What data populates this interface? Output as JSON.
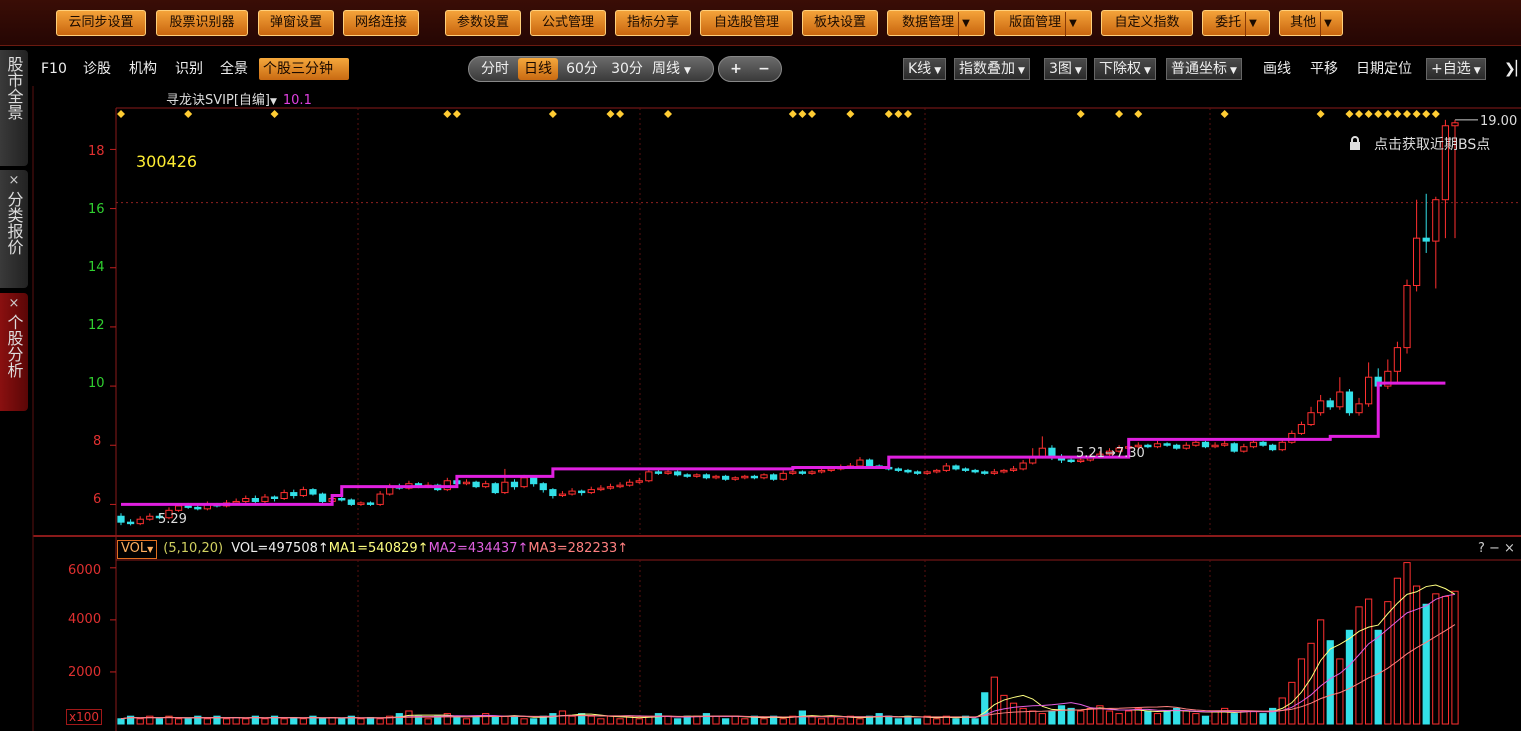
{
  "toolbar": {
    "buttons": [
      {
        "label": "云同步设置"
      },
      {
        "label": "股票识别器"
      },
      {
        "label": "弹窗设置"
      },
      {
        "label": "网络连接"
      },
      {
        "label": "参数设置"
      },
      {
        "label": "公式管理"
      },
      {
        "label": "指标分享"
      },
      {
        "label": "自选股管理"
      },
      {
        "label": "板块设置"
      },
      {
        "label": "数据管理"
      },
      {
        "label": "版面管理"
      },
      {
        "label": "自定义指数"
      },
      {
        "label": "委托"
      },
      {
        "label": "其他"
      }
    ]
  },
  "sidebar": {
    "tabs": [
      {
        "label": "股市全景"
      },
      {
        "label": "分类报价"
      },
      {
        "label": "个股分析"
      }
    ],
    "close_glyph": "×"
  },
  "subnav": {
    "items": [
      "F10",
      "诊股",
      "机构",
      "识别",
      "全景",
      "个股三分钟"
    ],
    "active": "个股三分钟",
    "periods": [
      "分时",
      "日线",
      "60分",
      "30分",
      "周线"
    ],
    "active_period": "日线",
    "zoom_in": "+",
    "zoom_out": "−",
    "right_buttons": [
      {
        "label": "K线",
        "dropdown": true
      },
      {
        "label": "指数叠加",
        "dropdown": true
      },
      {
        "label": "3图",
        "dropdown": true
      },
      {
        "label": "下除权",
        "dropdown": true
      },
      {
        "label": "普通坐标",
        "dropdown": true
      },
      {
        "label": "画线",
        "dropdown": false
      },
      {
        "label": "平移",
        "dropdown": false
      },
      {
        "label": "日期定位",
        "dropdown": false
      },
      {
        "label": "+自选",
        "dropdown": true
      }
    ],
    "collapse_icon": "sidebar-collapse-icon"
  },
  "indicator": {
    "name": "寻龙诀SVIP[自编]",
    "value": "10.1"
  },
  "stock": {
    "code": "300426"
  },
  "bs_hint": "点击获取近期BS点",
  "price_labels": {
    "max": "19.00",
    "min": "5.29",
    "mid": "5.21→7.30"
  },
  "volume_panel": {
    "indicator_button": "VOL",
    "params": "(5,10,20)",
    "vol": "VOL=497508↑",
    "ma1": "MA1=540829↑",
    "ma2": "MA2=434437↑",
    "ma3": "MA3=282233↑",
    "right_controls": "? − ×",
    "unit": "x100"
  },
  "colors": {
    "up": "#ff3030",
    "down": "#33e0e8",
    "indicator_line": "#e020e0",
    "signal": "#ffcc33",
    "ma1": "#ffff80",
    "ma2": "#e060e0",
    "ma3": "#ff8080",
    "toolbar_button": "#e8902a"
  },
  "chart_data": {
    "type": "candlestick",
    "price_axis": {
      "ticks": [
        6,
        8,
        10,
        12,
        14,
        16,
        18
      ],
      "ylim": [
        5,
        19.4
      ]
    },
    "volume_axis": {
      "ticks": [
        2000,
        4000,
        6000
      ],
      "ylim": [
        0,
        6300
      ]
    },
    "level_line": [
      {
        "from": 0,
        "to": 22,
        "value": 6.0
      },
      {
        "from": 22,
        "to": 23,
        "value": 6.3
      },
      {
        "from": 23,
        "to": 35,
        "value": 6.6
      },
      {
        "from": 35,
        "to": 45,
        "value": 6.95
      },
      {
        "from": 45,
        "to": 70,
        "value": 7.2
      },
      {
        "from": 70,
        "to": 80,
        "value": 7.25
      },
      {
        "from": 80,
        "to": 105,
        "value": 7.6
      },
      {
        "from": 105,
        "to": 126,
        "value": 8.2
      },
      {
        "from": 126,
        "to": 131,
        "value": 8.3
      },
      {
        "from": 131,
        "to": 138,
        "value": 10.1
      }
    ],
    "candles": [
      [
        5.6,
        5.4,
        5.7,
        5.3
      ],
      [
        5.4,
        5.35,
        5.5,
        5.29
      ],
      [
        5.35,
        5.5,
        5.6,
        5.3
      ],
      [
        5.5,
        5.6,
        5.7,
        5.45
      ],
      [
        5.6,
        5.55,
        5.7,
        5.5
      ],
      [
        5.55,
        5.8,
        5.9,
        5.5
      ],
      [
        5.8,
        5.95,
        6.0,
        5.75
      ],
      [
        5.95,
        5.9,
        6.05,
        5.85
      ],
      [
        5.9,
        5.85,
        6.0,
        5.8
      ],
      [
        5.85,
        6.0,
        6.1,
        5.8
      ],
      [
        6.0,
        5.95,
        6.05,
        5.9
      ],
      [
        5.95,
        6.05,
        6.15,
        5.9
      ],
      [
        6.05,
        6.1,
        6.2,
        6.0
      ],
      [
        6.1,
        6.2,
        6.3,
        6.05
      ],
      [
        6.2,
        6.1,
        6.3,
        6.05
      ],
      [
        6.1,
        6.25,
        6.35,
        6.05
      ],
      [
        6.25,
        6.2,
        6.3,
        6.1
      ],
      [
        6.2,
        6.4,
        6.5,
        6.15
      ],
      [
        6.4,
        6.3,
        6.5,
        6.2
      ],
      [
        6.3,
        6.5,
        6.6,
        6.25
      ],
      [
        6.5,
        6.35,
        6.55,
        6.3
      ],
      [
        6.35,
        6.1,
        6.4,
        6.0
      ],
      [
        6.1,
        6.2,
        6.3,
        6.05
      ],
      [
        6.2,
        6.15,
        6.25,
        6.1
      ],
      [
        6.15,
        6.0,
        6.2,
        5.95
      ],
      [
        6.0,
        6.05,
        6.1,
        5.95
      ],
      [
        6.05,
        6.0,
        6.1,
        5.95
      ],
      [
        6.0,
        6.35,
        6.45,
        5.95
      ],
      [
        6.35,
        6.6,
        6.7,
        6.3
      ],
      [
        6.6,
        6.55,
        6.7,
        6.5
      ],
      [
        6.55,
        6.7,
        6.8,
        6.5
      ],
      [
        6.7,
        6.6,
        6.75,
        6.55
      ],
      [
        6.6,
        6.65,
        6.75,
        6.55
      ],
      [
        6.65,
        6.5,
        6.7,
        6.45
      ],
      [
        6.5,
        6.8,
        6.9,
        6.45
      ],
      [
        6.8,
        6.7,
        6.9,
        6.65
      ],
      [
        6.7,
        6.75,
        6.85,
        6.65
      ],
      [
        6.75,
        6.6,
        6.8,
        6.55
      ],
      [
        6.6,
        6.7,
        6.8,
        6.55
      ],
      [
        6.7,
        6.4,
        6.75,
        6.35
      ],
      [
        6.4,
        6.75,
        7.2,
        6.35
      ],
      [
        6.75,
        6.6,
        6.85,
        6.5
      ],
      [
        6.6,
        6.9,
        7.0,
        6.55
      ],
      [
        6.9,
        6.7,
        6.95,
        6.6
      ],
      [
        6.7,
        6.5,
        6.75,
        6.4
      ],
      [
        6.5,
        6.3,
        6.55,
        6.2
      ],
      [
        6.3,
        6.35,
        6.45,
        6.25
      ],
      [
        6.35,
        6.45,
        6.55,
        6.3
      ],
      [
        6.45,
        6.4,
        6.5,
        6.3
      ],
      [
        6.4,
        6.5,
        6.6,
        6.35
      ],
      [
        6.5,
        6.55,
        6.65,
        6.45
      ],
      [
        6.55,
        6.6,
        6.7,
        6.5
      ],
      [
        6.6,
        6.65,
        6.75,
        6.55
      ],
      [
        6.65,
        6.75,
        6.85,
        6.6
      ],
      [
        6.75,
        6.8,
        6.9,
        6.7
      ],
      [
        6.8,
        7.1,
        7.25,
        6.75
      ],
      [
        7.1,
        7.05,
        7.2,
        7.0
      ],
      [
        7.05,
        7.1,
        7.2,
        7.0
      ],
      [
        7.1,
        7.0,
        7.15,
        6.95
      ],
      [
        7.0,
        6.95,
        7.05,
        6.9
      ],
      [
        6.95,
        7.0,
        7.05,
        6.9
      ],
      [
        7.0,
        6.9,
        7.05,
        6.85
      ],
      [
        6.9,
        6.95,
        7.0,
        6.85
      ],
      [
        6.95,
        6.85,
        7.0,
        6.8
      ],
      [
        6.85,
        6.9,
        6.95,
        6.8
      ],
      [
        6.9,
        6.95,
        7.0,
        6.85
      ],
      [
        6.95,
        6.9,
        7.0,
        6.85
      ],
      [
        6.9,
        7.0,
        7.05,
        6.85
      ],
      [
        7.0,
        6.85,
        7.05,
        6.8
      ],
      [
        6.85,
        7.05,
        7.15,
        6.8
      ],
      [
        7.05,
        7.1,
        7.2,
        7.0
      ],
      [
        7.1,
        7.05,
        7.15,
        7.0
      ],
      [
        7.05,
        7.1,
        7.15,
        7.0
      ],
      [
        7.1,
        7.15,
        7.2,
        7.05
      ],
      [
        7.15,
        7.2,
        7.3,
        7.1
      ],
      [
        7.2,
        7.25,
        7.35,
        7.15
      ],
      [
        7.25,
        7.3,
        7.4,
        7.2
      ],
      [
        7.3,
        7.5,
        7.6,
        7.25
      ],
      [
        7.5,
        7.3,
        7.55,
        7.2
      ],
      [
        7.3,
        7.25,
        7.35,
        7.2
      ],
      [
        7.25,
        7.2,
        7.3,
        7.15
      ],
      [
        7.2,
        7.15,
        7.25,
        7.1
      ],
      [
        7.15,
        7.1,
        7.2,
        7.05
      ],
      [
        7.1,
        7.05,
        7.15,
        7.0
      ],
      [
        7.05,
        7.1,
        7.15,
        7.0
      ],
      [
        7.1,
        7.15,
        7.2,
        7.05
      ],
      [
        7.15,
        7.3,
        7.4,
        7.1
      ],
      [
        7.3,
        7.2,
        7.35,
        7.15
      ],
      [
        7.2,
        7.15,
        7.25,
        7.1
      ],
      [
        7.15,
        7.1,
        7.2,
        7.05
      ],
      [
        7.1,
        7.05,
        7.15,
        7.0
      ],
      [
        7.05,
        7.1,
        7.2,
        7.0
      ],
      [
        7.1,
        7.15,
        7.2,
        7.05
      ],
      [
        7.15,
        7.2,
        7.3,
        7.1
      ],
      [
        7.2,
        7.4,
        7.5,
        7.15
      ],
      [
        7.4,
        7.6,
        7.9,
        7.35
      ],
      [
        7.6,
        7.9,
        8.3,
        7.55
      ],
      [
        7.9,
        7.6,
        8.0,
        7.5
      ],
      [
        7.6,
        7.5,
        7.7,
        7.4
      ],
      [
        7.5,
        7.45,
        7.6,
        7.4
      ],
      [
        7.45,
        7.5,
        7.6,
        7.4
      ],
      [
        7.5,
        7.6,
        7.7,
        7.45
      ],
      [
        7.6,
        7.7,
        7.8,
        7.55
      ],
      [
        7.7,
        7.8,
        7.9,
        7.65
      ],
      [
        7.8,
        7.9,
        8.0,
        7.75
      ],
      [
        7.9,
        7.95,
        8.05,
        7.85
      ],
      [
        7.95,
        8.0,
        8.1,
        7.9
      ],
      [
        8.0,
        7.95,
        8.05,
        7.9
      ],
      [
        7.95,
        8.05,
        8.15,
        7.9
      ],
      [
        8.05,
        8.0,
        8.1,
        7.95
      ],
      [
        8.0,
        7.9,
        8.05,
        7.85
      ],
      [
        7.9,
        8.0,
        8.1,
        7.85
      ],
      [
        8.0,
        8.1,
        8.2,
        7.95
      ],
      [
        8.1,
        7.95,
        8.15,
        7.9
      ],
      [
        7.95,
        8.0,
        8.1,
        7.9
      ],
      [
        8.0,
        8.05,
        8.15,
        7.95
      ],
      [
        8.05,
        7.8,
        8.1,
        7.75
      ],
      [
        7.8,
        7.95,
        8.05,
        7.75
      ],
      [
        7.95,
        8.1,
        8.2,
        7.9
      ],
      [
        8.1,
        8.0,
        8.15,
        7.95
      ],
      [
        8.0,
        7.85,
        8.05,
        7.8
      ],
      [
        7.85,
        8.1,
        8.2,
        7.8
      ],
      [
        8.1,
        8.4,
        8.5,
        8.05
      ],
      [
        8.4,
        8.7,
        8.8,
        8.35
      ],
      [
        8.7,
        9.1,
        9.3,
        8.65
      ],
      [
        9.1,
        9.5,
        9.7,
        9.0
      ],
      [
        9.5,
        9.3,
        9.6,
        9.2
      ],
      [
        9.3,
        9.8,
        10.3,
        9.2
      ],
      [
        9.8,
        9.1,
        9.9,
        9.0
      ],
      [
        9.1,
        9.4,
        9.6,
        9.0
      ],
      [
        9.4,
        10.3,
        10.8,
        9.3
      ],
      [
        10.3,
        10.0,
        10.6,
        9.8
      ],
      [
        10.0,
        10.5,
        10.9,
        9.9
      ],
      [
        10.5,
        11.3,
        11.5,
        10.1
      ],
      [
        11.3,
        13.4,
        13.6,
        11.1
      ],
      [
        13.4,
        15.0,
        16.3,
        13.2
      ],
      [
        15.0,
        14.9,
        16.5,
        14.5
      ],
      [
        14.9,
        16.3,
        16.4,
        13.3
      ],
      [
        16.3,
        18.8,
        19.0,
        15.0
      ],
      [
        18.8,
        18.9,
        19.0,
        15.0
      ]
    ],
    "volume_samples": [
      0.2,
      0.3,
      0.2,
      0.3,
      0.2,
      0.3,
      0.2,
      0.2,
      0.3,
      0.2,
      0.3,
      0.2,
      0.25,
      0.2,
      0.3,
      0.2,
      0.3,
      0.2,
      0.25,
      0.2,
      0.3,
      0.2,
      0.25,
      0.2,
      0.3,
      0.2,
      0.25,
      0.2,
      0.3,
      0.4,
      0.5,
      0.3,
      0.2,
      0.3,
      0.4,
      0.3,
      0.2,
      0.3,
      0.4,
      0.3,
      0.3,
      0.3,
      0.2,
      0.2,
      0.3,
      0.4,
      0.5,
      0.3,
      0.4,
      0.3,
      0.2,
      0.3,
      0.2,
      0.3,
      0.2,
      0.3,
      0.4,
      0.3,
      0.2,
      0.3,
      0.3,
      0.4,
      0.3,
      0.2,
      0.3,
      0.2,
      0.3,
      0.2,
      0.3,
      0.2,
      0.3,
      0.5,
      0.3,
      0.2,
      0.3,
      0.2,
      0.3,
      0.2,
      0.3,
      0.4,
      0.3,
      0.2,
      0.3,
      0.2,
      0.3,
      0.2,
      0.3,
      0.2,
      0.3,
      0.2,
      1.2,
      1.8,
      1.1,
      0.8,
      0.6,
      0.5,
      0.4,
      0.5,
      0.7,
      0.6,
      0.5,
      0.6,
      0.7,
      0.5,
      0.4,
      0.5,
      0.6,
      0.5,
      0.4,
      0.5,
      0.6,
      0.5,
      0.4,
      0.3,
      0.5,
      0.6,
      0.4,
      0.5,
      0.5,
      0.4,
      0.6,
      1.0,
      1.6,
      2.5,
      3.1,
      4.0,
      3.2,
      2.5,
      3.6,
      4.5,
      4.8,
      3.6,
      4.7,
      5.6,
      6.2,
      5.3,
      4.6,
      5.0,
      4.9,
      5.1
    ],
    "signal_markers_count": 31
  }
}
